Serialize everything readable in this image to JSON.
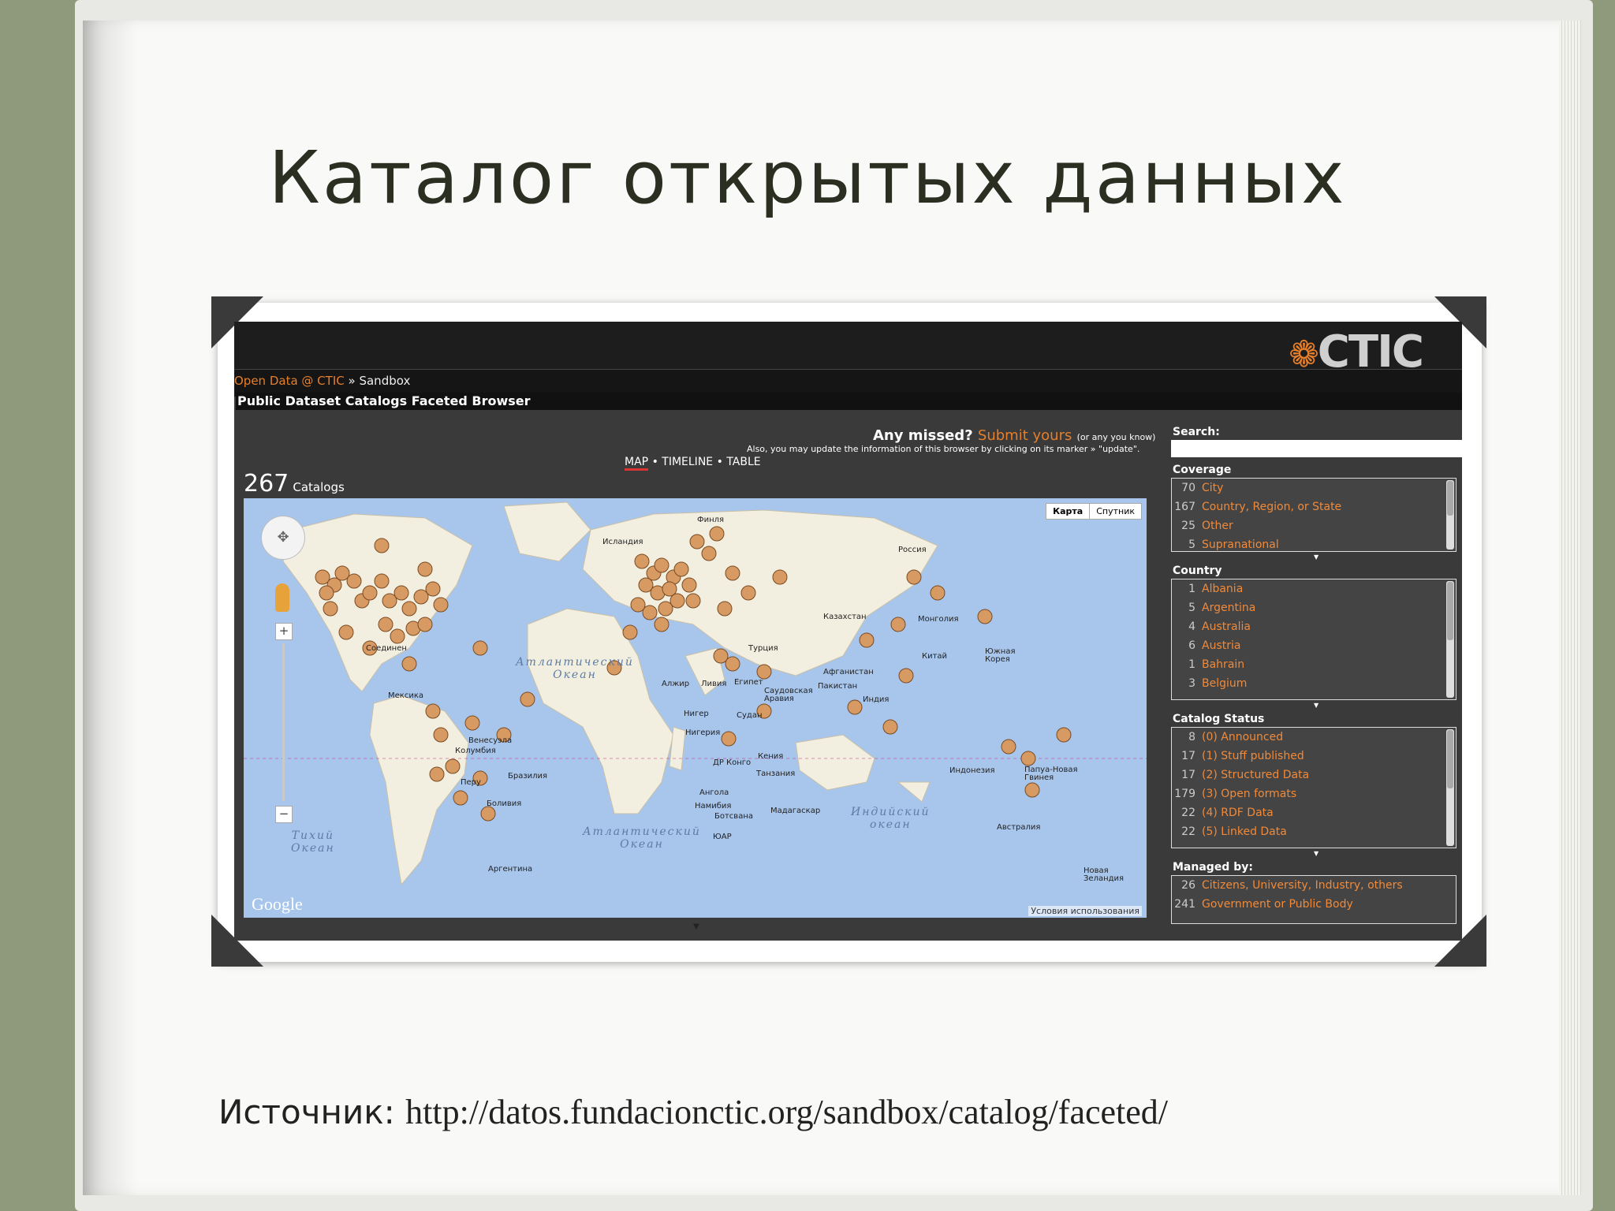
{
  "slide": {
    "title": "Каталог открытых данных",
    "source_label": "Источник",
    "source_sep": ":",
    "source_url": "http://datos.fundacionctic.org/sandbox/catalog/faceted/"
  },
  "site": {
    "logo": "CTIC",
    "breadcrumb_link": "Open Data @ CTIC",
    "breadcrumb_sep": "»",
    "breadcrumb_current": "Sandbox",
    "page_title": "Public Dataset Catalogs Faceted Browser",
    "missed_text": "Any missed?",
    "submit_link": "Submit yours",
    "submit_hint": "(or any you know)",
    "update_note": "Also, you may update the information of this browser by clicking on its marker » \"update\".",
    "views": {
      "map": "MAP",
      "timeline": "TIMELINE",
      "table": "TABLE",
      "sep": "•"
    },
    "catalog_count": "267",
    "catalog_label": "Catalogs"
  },
  "map": {
    "toggle_map": "Карта",
    "toggle_sat": "Спутник",
    "attribution": "Google",
    "terms": "Условия использования",
    "oceans": [
      {
        "name": "Атлантический\nОкеан"
      },
      {
        "name": "Атлантический\nОкеан"
      },
      {
        "name": "Индийский\nокеан"
      },
      {
        "name": "Тихий\nОкеан"
      }
    ],
    "places": [
      "Исландия",
      "Россия",
      "Казахстан",
      "Монголия",
      "Турция",
      "Алжир",
      "Ливия",
      "Египет",
      "Нигер",
      "Судан",
      "Нигерия",
      "ДР Конго",
      "Кения",
      "Танзания",
      "Ангола",
      "Намибия",
      "Ботсвана",
      "ЮАР",
      "Мадагаскар",
      "Саудовская\nАравия",
      "Афганистан",
      "Пакистан",
      "Индия",
      "Китай",
      "Южная\nКорея",
      "Индонезия",
      "Папуа-Новая\nГвинея",
      "Австралия",
      "Новая\nЗеландия",
      "Соединен",
      "Мексика",
      "Венесуэла",
      "Колумбия",
      "Перу",
      "Бразилия",
      "Боливия",
      "Аргентина",
      "Финля"
    ]
  },
  "sidebar": {
    "search_label": "Search:",
    "facets": [
      {
        "title": "Coverage",
        "items": [
          {
            "count": "70",
            "name": "City"
          },
          {
            "count": "167",
            "name": "Country, Region, or State"
          },
          {
            "count": "25",
            "name": "Other"
          },
          {
            "count": "5",
            "name": "Supranational"
          }
        ]
      },
      {
        "title": "Country",
        "items": [
          {
            "count": "1",
            "name": "Albania"
          },
          {
            "count": "5",
            "name": "Argentina"
          },
          {
            "count": "4",
            "name": "Australia"
          },
          {
            "count": "6",
            "name": "Austria"
          },
          {
            "count": "1",
            "name": "Bahrain"
          },
          {
            "count": "3",
            "name": "Belgium"
          }
        ]
      },
      {
        "title": "Catalog Status",
        "items": [
          {
            "count": "8",
            "name": "(0) Announced"
          },
          {
            "count": "17",
            "name": "(1) Stuff published"
          },
          {
            "count": "17",
            "name": "(2) Structured Data"
          },
          {
            "count": "179",
            "name": "(3) Open formats"
          },
          {
            "count": "22",
            "name": "(4) RDF Data"
          },
          {
            "count": "22",
            "name": "(5) Linked Data"
          }
        ]
      },
      {
        "title": "Managed by:",
        "items": [
          {
            "count": "26",
            "name": "Citizens, University, Industry, others"
          },
          {
            "count": "241",
            "name": "Government or Public Body"
          }
        ]
      }
    ]
  },
  "colors": {
    "accent": "#e57f2b",
    "map_ocean": "#a8c6ec",
    "land": "#f3efe0",
    "marker": "#d89a63"
  }
}
